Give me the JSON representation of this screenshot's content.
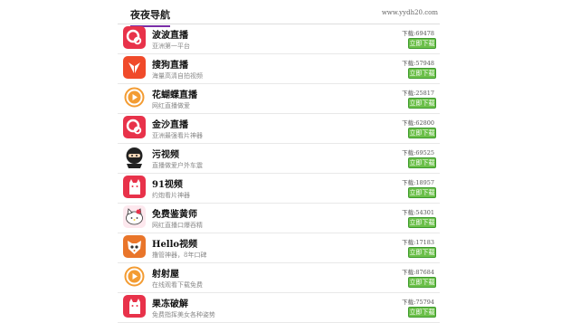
{
  "header": {
    "title": "夜夜导航",
    "domain": "www.yydh20.com"
  },
  "download_prefix": "下载:",
  "apps": [
    {
      "name": "波波直播",
      "desc": "亚洲第一平台",
      "downloads": "69478",
      "button": "立即下载",
      "icon": "popo-icon",
      "color": "#e8324a"
    },
    {
      "name": "搜狗直播",
      "desc": "海量高清自拍视频",
      "downloads": "57948",
      "button": "立即下载",
      "icon": "wing-icon",
      "color": "#f04a2a"
    },
    {
      "name": "花蝴蝶直播",
      "desc": "网红直播做爱",
      "downloads": "25817",
      "button": "立即下载",
      "icon": "play-icon",
      "color": "#f39c33"
    },
    {
      "name": "金沙直播",
      "desc": "亚洲最强看片神器",
      "downloads": "62800",
      "button": "立即下载",
      "icon": "popo-icon",
      "color": "#e8324a"
    },
    {
      "name": "污视频",
      "desc": "直播做爱户外车震",
      "downloads": "69525",
      "button": "立即下载",
      "icon": "ninja-icon",
      "color": "#222222"
    },
    {
      "name": "91视频",
      "desc": "约炮看片神器",
      "downloads": "18957",
      "button": "立即下载",
      "icon": "cat-icon",
      "color": "#e8324a"
    },
    {
      "name": "免费鉴黄师",
      "desc": "网红直播口爆吞精",
      "downloads": "54301",
      "button": "立即下载",
      "icon": "kitty-icon",
      "color": "#f3b8c6"
    },
    {
      "name": "Hello视频",
      "desc": "撸管神器，8年口碑",
      "downloads": "17183",
      "button": "立即下载",
      "icon": "fox-icon",
      "color": "#e9752a"
    },
    {
      "name": "射射屋",
      "desc": "在线观看下载免费",
      "downloads": "87684",
      "button": "立即下载",
      "icon": "play-icon",
      "color": "#f39c33"
    },
    {
      "name": "果冻破解",
      "desc": "免费指挥美女各种姿势",
      "downloads": "75794",
      "button": "立即下载",
      "icon": "cat-icon",
      "color": "#e8324a"
    }
  ]
}
